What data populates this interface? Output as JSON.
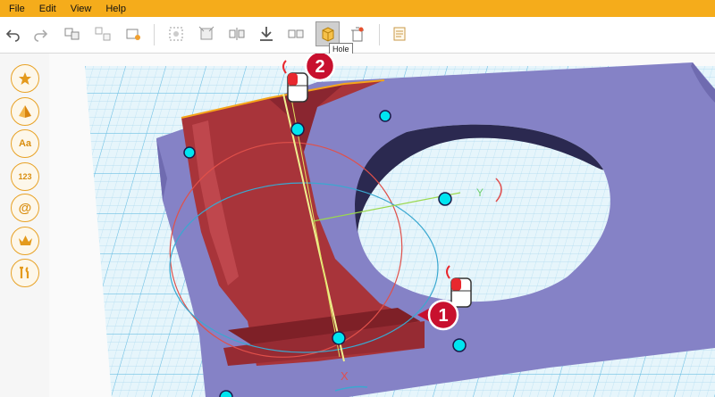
{
  "menu": {
    "file": "File",
    "edit": "Edit",
    "view": "View",
    "help": "Help"
  },
  "toolbar": {
    "tooltip": "Hole",
    "items": [
      "undo-icon",
      "redo-icon",
      "group-icon",
      "ungroup-icon",
      "package-icon",
      "align-icon",
      "snap-icon",
      "mirror-icon",
      "download-icon",
      "split-icon",
      "hole-icon",
      "delete-icon",
      "notes-icon"
    ]
  },
  "sidebar": {
    "items": [
      {
        "name": "favorites",
        "icon": "star-icon",
        "label": ""
      },
      {
        "name": "shapes",
        "icon": "pyramid-icon",
        "label": ""
      },
      {
        "name": "text",
        "icon": "text-icon",
        "label": "Aa"
      },
      {
        "name": "numbers",
        "icon": "numbers-icon",
        "label": "123"
      },
      {
        "name": "symbols",
        "icon": "at-icon",
        "label": "@"
      },
      {
        "name": "crown",
        "icon": "crown-icon",
        "label": ""
      },
      {
        "name": "tools",
        "icon": "tools-icon",
        "label": ""
      }
    ]
  },
  "callouts": {
    "step1": "1",
    "step2": "2"
  },
  "colors": {
    "menubar": "#f5ac1b",
    "grid_bg": "#e6f5fb",
    "grid_line": "#9fd6ec",
    "plate": "#8582c6",
    "plate_dark": "#6f6bb0",
    "part_red": "#a8343a",
    "handle": "#00e5f0"
  }
}
